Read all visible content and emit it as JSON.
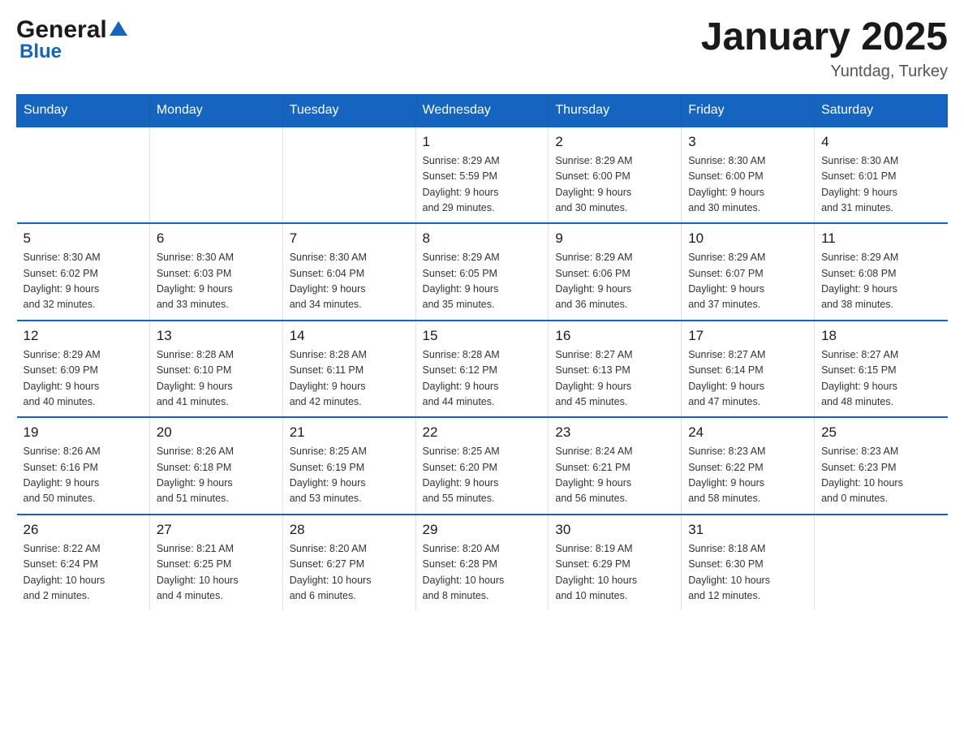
{
  "logo": {
    "general": "General",
    "triangle": "▲",
    "blue": "Blue"
  },
  "title": "January 2025",
  "location": "Yuntdag, Turkey",
  "days_of_week": [
    "Sunday",
    "Monday",
    "Tuesday",
    "Wednesday",
    "Thursday",
    "Friday",
    "Saturday"
  ],
  "weeks": [
    [
      {
        "day": "",
        "info": ""
      },
      {
        "day": "",
        "info": ""
      },
      {
        "day": "",
        "info": ""
      },
      {
        "day": "1",
        "info": "Sunrise: 8:29 AM\nSunset: 5:59 PM\nDaylight: 9 hours\nand 29 minutes."
      },
      {
        "day": "2",
        "info": "Sunrise: 8:29 AM\nSunset: 6:00 PM\nDaylight: 9 hours\nand 30 minutes."
      },
      {
        "day": "3",
        "info": "Sunrise: 8:30 AM\nSunset: 6:00 PM\nDaylight: 9 hours\nand 30 minutes."
      },
      {
        "day": "4",
        "info": "Sunrise: 8:30 AM\nSunset: 6:01 PM\nDaylight: 9 hours\nand 31 minutes."
      }
    ],
    [
      {
        "day": "5",
        "info": "Sunrise: 8:30 AM\nSunset: 6:02 PM\nDaylight: 9 hours\nand 32 minutes."
      },
      {
        "day": "6",
        "info": "Sunrise: 8:30 AM\nSunset: 6:03 PM\nDaylight: 9 hours\nand 33 minutes."
      },
      {
        "day": "7",
        "info": "Sunrise: 8:30 AM\nSunset: 6:04 PM\nDaylight: 9 hours\nand 34 minutes."
      },
      {
        "day": "8",
        "info": "Sunrise: 8:29 AM\nSunset: 6:05 PM\nDaylight: 9 hours\nand 35 minutes."
      },
      {
        "day": "9",
        "info": "Sunrise: 8:29 AM\nSunset: 6:06 PM\nDaylight: 9 hours\nand 36 minutes."
      },
      {
        "day": "10",
        "info": "Sunrise: 8:29 AM\nSunset: 6:07 PM\nDaylight: 9 hours\nand 37 minutes."
      },
      {
        "day": "11",
        "info": "Sunrise: 8:29 AM\nSunset: 6:08 PM\nDaylight: 9 hours\nand 38 minutes."
      }
    ],
    [
      {
        "day": "12",
        "info": "Sunrise: 8:29 AM\nSunset: 6:09 PM\nDaylight: 9 hours\nand 40 minutes."
      },
      {
        "day": "13",
        "info": "Sunrise: 8:28 AM\nSunset: 6:10 PM\nDaylight: 9 hours\nand 41 minutes."
      },
      {
        "day": "14",
        "info": "Sunrise: 8:28 AM\nSunset: 6:11 PM\nDaylight: 9 hours\nand 42 minutes."
      },
      {
        "day": "15",
        "info": "Sunrise: 8:28 AM\nSunset: 6:12 PM\nDaylight: 9 hours\nand 44 minutes."
      },
      {
        "day": "16",
        "info": "Sunrise: 8:27 AM\nSunset: 6:13 PM\nDaylight: 9 hours\nand 45 minutes."
      },
      {
        "day": "17",
        "info": "Sunrise: 8:27 AM\nSunset: 6:14 PM\nDaylight: 9 hours\nand 47 minutes."
      },
      {
        "day": "18",
        "info": "Sunrise: 8:27 AM\nSunset: 6:15 PM\nDaylight: 9 hours\nand 48 minutes."
      }
    ],
    [
      {
        "day": "19",
        "info": "Sunrise: 8:26 AM\nSunset: 6:16 PM\nDaylight: 9 hours\nand 50 minutes."
      },
      {
        "day": "20",
        "info": "Sunrise: 8:26 AM\nSunset: 6:18 PM\nDaylight: 9 hours\nand 51 minutes."
      },
      {
        "day": "21",
        "info": "Sunrise: 8:25 AM\nSunset: 6:19 PM\nDaylight: 9 hours\nand 53 minutes."
      },
      {
        "day": "22",
        "info": "Sunrise: 8:25 AM\nSunset: 6:20 PM\nDaylight: 9 hours\nand 55 minutes."
      },
      {
        "day": "23",
        "info": "Sunrise: 8:24 AM\nSunset: 6:21 PM\nDaylight: 9 hours\nand 56 minutes."
      },
      {
        "day": "24",
        "info": "Sunrise: 8:23 AM\nSunset: 6:22 PM\nDaylight: 9 hours\nand 58 minutes."
      },
      {
        "day": "25",
        "info": "Sunrise: 8:23 AM\nSunset: 6:23 PM\nDaylight: 10 hours\nand 0 minutes."
      }
    ],
    [
      {
        "day": "26",
        "info": "Sunrise: 8:22 AM\nSunset: 6:24 PM\nDaylight: 10 hours\nand 2 minutes."
      },
      {
        "day": "27",
        "info": "Sunrise: 8:21 AM\nSunset: 6:25 PM\nDaylight: 10 hours\nand 4 minutes."
      },
      {
        "day": "28",
        "info": "Sunrise: 8:20 AM\nSunset: 6:27 PM\nDaylight: 10 hours\nand 6 minutes."
      },
      {
        "day": "29",
        "info": "Sunrise: 8:20 AM\nSunset: 6:28 PM\nDaylight: 10 hours\nand 8 minutes."
      },
      {
        "day": "30",
        "info": "Sunrise: 8:19 AM\nSunset: 6:29 PM\nDaylight: 10 hours\nand 10 minutes."
      },
      {
        "day": "31",
        "info": "Sunrise: 8:18 AM\nSunset: 6:30 PM\nDaylight: 10 hours\nand 12 minutes."
      },
      {
        "day": "",
        "info": ""
      }
    ]
  ]
}
